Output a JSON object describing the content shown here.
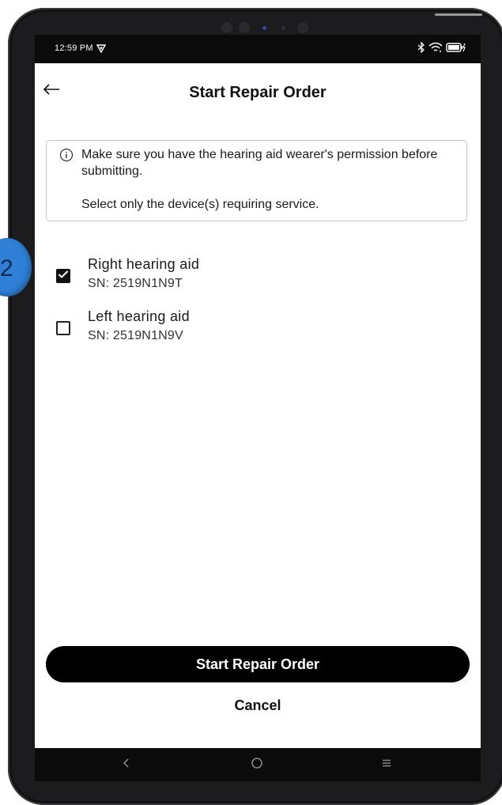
{
  "status_bar": {
    "time": "12:59 PM"
  },
  "header": {
    "title": "Start Repair Order",
    "back_icon": "arrow-left-icon"
  },
  "info": {
    "line1": "Make sure you have the hearing aid wearer's permission before submitting.",
    "line2": "Select only the device(s) requiring service.",
    "icon": "info-circle-icon"
  },
  "devices": [
    {
      "name": "Right hearing aid",
      "serial": "SN: 2519N1N9T",
      "checked": true
    },
    {
      "name": "Left hearing aid",
      "serial": "SN: 2519N1N9V",
      "checked": false
    }
  ],
  "actions": {
    "primary_label": "Start Repair Order",
    "cancel_label": "Cancel"
  },
  "step_badge": {
    "number": "2",
    "color": "#2f7fd6"
  },
  "nav": {
    "back": "nav-back-icon",
    "home": "nav-home-icon",
    "menu": "nav-menu-icon"
  }
}
